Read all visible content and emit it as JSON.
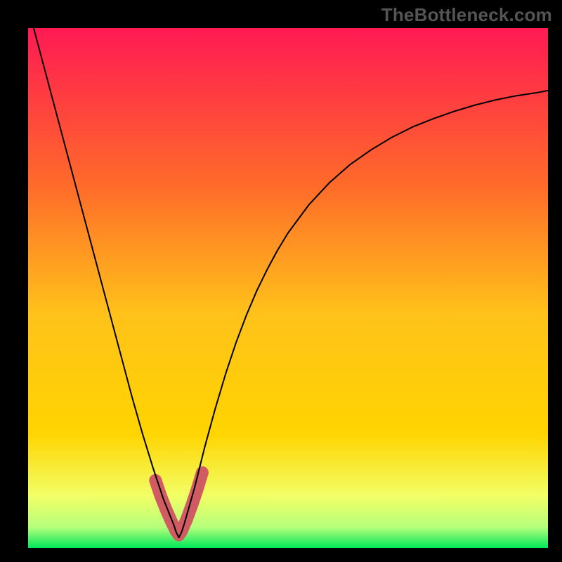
{
  "attribution": "TheBottleneck.com",
  "chart_data": {
    "type": "line",
    "title": "",
    "xlabel": "",
    "ylabel": "",
    "xlim": [
      0,
      1
    ],
    "ylim": [
      0,
      1
    ],
    "background_gradient": {
      "top_color": "#ff1a53",
      "mid_color": "#ffd400",
      "lower_color": "#f2ff66",
      "bottom_color": "#00e85c"
    },
    "valley_x": 0.29,
    "series": [
      {
        "name": "main-curve",
        "color": "#000000",
        "stroke_width": 2,
        "x": [
          0.0,
          0.02,
          0.04,
          0.06,
          0.08,
          0.1,
          0.12,
          0.14,
          0.16,
          0.18,
          0.2,
          0.22,
          0.24,
          0.25,
          0.26,
          0.27,
          0.28,
          0.285,
          0.29,
          0.295,
          0.3,
          0.31,
          0.32,
          0.33,
          0.34,
          0.36,
          0.38,
          0.4,
          0.42,
          0.44,
          0.46,
          0.48,
          0.5,
          0.54,
          0.58,
          0.62,
          0.66,
          0.7,
          0.74,
          0.78,
          0.82,
          0.86,
          0.9,
          0.94,
          0.98,
          1.0
        ],
        "y": [
          1.04,
          0.965,
          0.89,
          0.815,
          0.74,
          0.665,
          0.59,
          0.515,
          0.44,
          0.365,
          0.29,
          0.22,
          0.155,
          0.125,
          0.095,
          0.07,
          0.045,
          0.03,
          0.02,
          0.03,
          0.045,
          0.08,
          0.115,
          0.155,
          0.195,
          0.268,
          0.335,
          0.395,
          0.448,
          0.495,
          0.536,
          0.573,
          0.606,
          0.66,
          0.703,
          0.738,
          0.766,
          0.79,
          0.81,
          0.826,
          0.84,
          0.852,
          0.862,
          0.87,
          0.876,
          0.88
        ]
      },
      {
        "name": "valley-highlight",
        "color": "#d15b62",
        "stroke_width": 18,
        "x": [
          0.245,
          0.255,
          0.265,
          0.275,
          0.285,
          0.29,
          0.295,
          0.305,
          0.315,
          0.325,
          0.335
        ],
        "y": [
          0.13,
          0.1,
          0.075,
          0.052,
          0.032,
          0.025,
          0.032,
          0.055,
          0.082,
          0.112,
          0.145
        ]
      }
    ]
  }
}
